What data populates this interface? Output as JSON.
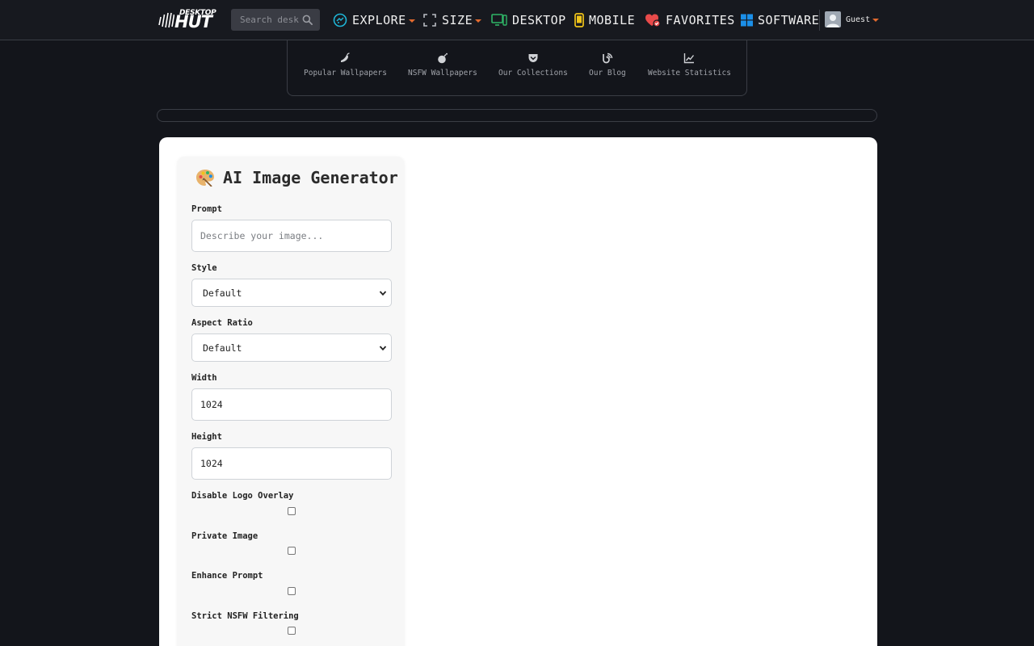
{
  "brand": {
    "small": "DESKTOP",
    "big": "HUT"
  },
  "search": {
    "placeholder": "Search desktophut"
  },
  "nav": {
    "explore": "EXPLORE",
    "size": "SIZE",
    "desktop": "DESKTOP",
    "mobile": "MOBILE",
    "favorites": "FAVORITES",
    "software": "SOFTWARE",
    "user": "Guest"
  },
  "subnav": {
    "popular": "Popular Wallpapers",
    "nsfw": "NSFW Wallpapers",
    "collections": "Our Collections",
    "blog": "Our Blog",
    "stats": "Website Statistics"
  },
  "generator": {
    "title": "AI Image Generator",
    "prompt_label": "Prompt",
    "prompt_placeholder": "Describe your image...",
    "style_label": "Style",
    "style_value": "Default",
    "aspect_label": "Aspect Ratio",
    "aspect_value": "Default",
    "width_label": "Width",
    "width_value": "1024",
    "height_label": "Height",
    "height_value": "1024",
    "logo_label": "Disable Logo Overlay",
    "private_label": "Private Image",
    "enhance_label": "Enhance Prompt",
    "strict_label": "Strict NSFW Filtering"
  },
  "colors": {
    "accent_orange": "#e36a2f",
    "explore_icon": "#1fb5d6",
    "desktop_icon": "#2fb567",
    "mobile_icon": "#f0c419",
    "favorites_icon": "#e84a4a",
    "software_icon": "#1b8fe8"
  }
}
